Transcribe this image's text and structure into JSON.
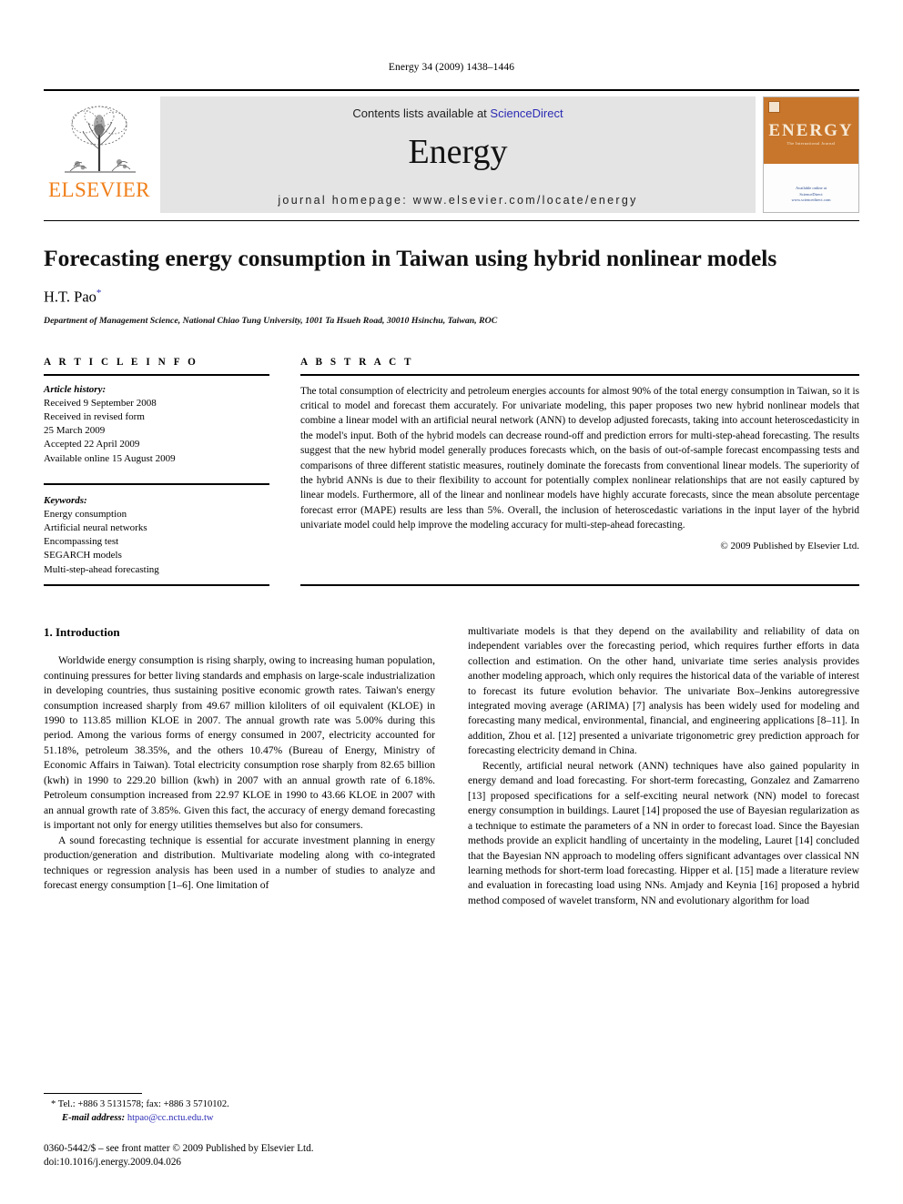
{
  "running_head": "Energy 34 (2009) 1438–1446",
  "masthead": {
    "publisher_wordmark": "ELSEVIER",
    "contents_prefix": "Contents lists available at ",
    "contents_link": "ScienceDirect",
    "journal_name": "Energy",
    "homepage": "journal homepage: www.elsevier.com/locate/energy",
    "cover": {
      "title": "ENERGY",
      "subtitle": "The International Journal",
      "footer_line1": "Available online at",
      "footer_line2": "ScienceDirect",
      "footer_line3": "www.sciencedirect.com"
    }
  },
  "article": {
    "title": "Forecasting energy consumption in Taiwan using hybrid nonlinear models",
    "author": "H.T. Pao",
    "author_marker": "*",
    "affiliation": "Department of Management Science, National Chiao Tung University, 1001 Ta Hsueh Road, 30010 Hsinchu, Taiwan, ROC"
  },
  "article_info": {
    "heading": "A R T I C L E  I N F O",
    "history_label": "Article history:",
    "history": [
      "Received 9 September 2008",
      "Received in revised form",
      "25 March 2009",
      "Accepted 22 April 2009",
      "Available online 15 August 2009"
    ],
    "keywords_label": "Keywords:",
    "keywords": [
      "Energy consumption",
      "Artificial neural networks",
      "Encompassing test",
      "SEGARCH models",
      "Multi-step-ahead forecasting"
    ]
  },
  "abstract": {
    "heading": "A B S T R A C T",
    "text": "The total consumption of electricity and petroleum energies accounts for almost 90% of the total energy consumption in Taiwan, so it is critical to model and forecast them accurately. For univariate modeling, this paper proposes two new hybrid nonlinear models that combine a linear model with an artificial neural network (ANN) to develop adjusted forecasts, taking into account heteroscedasticity in the model's input. Both of the hybrid models can decrease round-off and prediction errors for multi-step-ahead forecasting. The results suggest that the new hybrid model generally produces forecasts which, on the basis of out-of-sample forecast encompassing tests and comparisons of three different statistic measures, routinely dominate the forecasts from conventional linear models. The superiority of the hybrid ANNs is due to their flexibility to account for potentially complex nonlinear relationships that are not easily captured by linear models. Furthermore, all of the linear and nonlinear models have highly accurate forecasts, since the mean absolute percentage forecast error (MAPE) results are less than 5%. Overall, the inclusion of heteroscedastic variations in the input layer of the hybrid univariate model could help improve the modeling accuracy for multi-step-ahead forecasting.",
    "copyright": "© 2009 Published by Elsevier Ltd."
  },
  "body": {
    "section_number_title": "1.  Introduction",
    "left_paragraphs": [
      "Worldwide energy consumption is rising sharply, owing to increasing human population, continuing pressures for better living standards and emphasis on large-scale industrialization in developing countries, thus sustaining positive economic growth rates. Taiwan's energy consumption increased sharply from 49.67 million kiloliters of oil equivalent (KLOE) in 1990 to 113.85 million KLOE in 2007. The annual growth rate was 5.00% during this period. Among the various forms of energy consumed in 2007, electricity accounted for 51.18%, petroleum 38.35%, and the others 10.47% (Bureau of Energy, Ministry of Economic Affairs in Taiwan). Total electricity consumption rose sharply from 82.65 billion (kwh) in 1990 to 229.20 billion (kwh) in 2007 with an annual growth rate of 6.18%. Petroleum consumption increased from 22.97 KLOE in 1990 to 43.66 KLOE in 2007 with an annual growth rate of 3.85%. Given this fact, the accuracy of energy demand forecasting is important not only for energy utilities themselves but also for consumers.",
      "A sound forecasting technique is essential for accurate investment planning in energy production/generation and distribution. Multivariate modeling along with co-integrated techniques or regression analysis has been used in a number of studies to analyze and forecast energy consumption [1–6]. One limitation of"
    ],
    "right_paragraphs": [
      "multivariate models is that they depend on the availability and reliability of data on independent variables over the forecasting period, which requires further efforts in data collection and estimation. On the other hand, univariate time series analysis provides another modeling approach, which only requires the historical data of the variable of interest to forecast its future evolution behavior. The univariate Box–Jenkins autoregressive integrated moving average (ARIMA) [7] analysis has been widely used for modeling and forecasting many medical, environmental, financial, and engineering applications [8–11]. In addition, Zhou et al. [12] presented a univariate trigonometric grey prediction approach for forecasting electricity demand in China.",
      "Recently, artificial neural network (ANN) techniques have also gained popularity in energy demand and load forecasting. For short-term forecasting, Gonzalez and Zamarreno [13] proposed specifications for a self-exciting neural network (NN) model to forecast energy consumption in buildings. Lauret [14] proposed the use of Bayesian regularization as a technique to estimate the parameters of a NN in order to forecast load. Since the Bayesian methods provide an explicit handling of uncertainty in the modeling, Lauret [14] concluded that the Bayesian NN approach to modeling offers significant advantages over classical NN learning methods for short-term load forecasting. Hipper et al. [15] made a literature review and evaluation in forecasting load using NNs. Amjady and Keynia [16] proposed a hybrid method composed of wavelet transform, NN and evolutionary algorithm for load"
    ]
  },
  "footnotes": {
    "corresponding": "* Tel.: +886 3 5131578; fax: +886 3 5710102.",
    "email_label": "E-mail address:",
    "email": "htpao@cc.nctu.edu.tw",
    "imprint_line1": "0360-5442/$ – see front matter © 2009 Published by Elsevier Ltd.",
    "imprint_line2": "doi:10.1016/j.energy.2009.04.026"
  },
  "colors": {
    "link_blue": "#2B2BB5",
    "elsevier_orange": "#F07F1A",
    "banner_gray": "#e4e4e4",
    "cover_orange": "#C8762B"
  }
}
